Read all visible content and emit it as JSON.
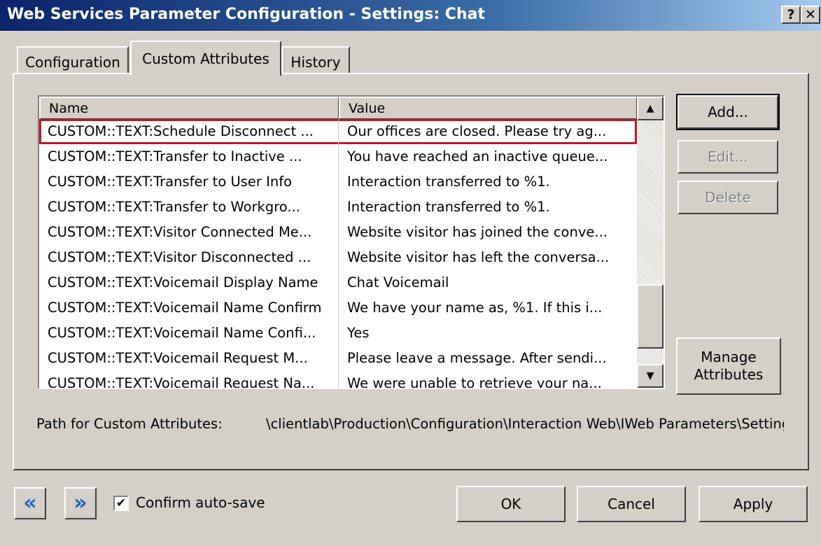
{
  "window": {
    "title": "Web Services Parameter Configuration - Settings: Chat",
    "help_glyph": "?",
    "close_glyph": "✕"
  },
  "tabs": [
    {
      "label": "Configuration",
      "active": false
    },
    {
      "label": "Custom Attributes",
      "active": true
    },
    {
      "label": "History",
      "active": false
    }
  ],
  "list": {
    "columns": {
      "name": "Name",
      "value": "Value"
    },
    "rows": [
      {
        "name": "CUSTOM::TEXT:Schedule Disconnect ...",
        "value": "Our offices are closed. Please try ag...",
        "selected": true
      },
      {
        "name": "CUSTOM::TEXT:Transfer to Inactive ...",
        "value": "You have reached an inactive queue..."
      },
      {
        "name": "CUSTOM::TEXT:Transfer to User Info",
        "value": "Interaction transferred to %1."
      },
      {
        "name": "CUSTOM::TEXT:Transfer to Workgro...",
        "value": "Interaction transferred to %1."
      },
      {
        "name": "CUSTOM::TEXT:Visitor Connected Me...",
        "value": "Website visitor has joined the conve..."
      },
      {
        "name": "CUSTOM::TEXT:Visitor Disconnected ...",
        "value": "Website visitor has left the conversa..."
      },
      {
        "name": "CUSTOM::TEXT:Voicemail Display Name",
        "value": "Chat Voicemail"
      },
      {
        "name": "CUSTOM::TEXT:Voicemail Name Confirm",
        "value": "We have your name as, %1. If this i..."
      },
      {
        "name": "CUSTOM::TEXT:Voicemail Name Confi...",
        "value": "Yes"
      },
      {
        "name": "CUSTOM::TEXT:Voicemail Request M...",
        "value": "Please leave a message. After sendi..."
      },
      {
        "name": "CUSTOM::TEXT:Voicemail Request Na...",
        "value": "We were unable to retrieve your na..."
      }
    ],
    "scroll_up_glyph": "▲",
    "scroll_down_glyph": "▼"
  },
  "side_buttons": {
    "add": "Add...",
    "edit": "Edit...",
    "delete": "Delete",
    "manage": "Manage\nAttributes"
  },
  "path": {
    "label": "Path for Custom Attributes:",
    "value": "\\clientlab\\Production\\Configuration\\Interaction Web\\IWeb Parameters\\Settings: Chat"
  },
  "footer": {
    "prev_glyph": "«",
    "next_glyph": "»",
    "confirm_checked": true,
    "check_glyph": "✔",
    "confirm_label": "Confirm auto-save",
    "ok": "OK",
    "cancel": "Cancel",
    "apply": "Apply"
  },
  "colors": {
    "selection_outline": "#c0182a",
    "nav_arrow": "#1a5fd0",
    "title_bar": "#0a246a"
  }
}
